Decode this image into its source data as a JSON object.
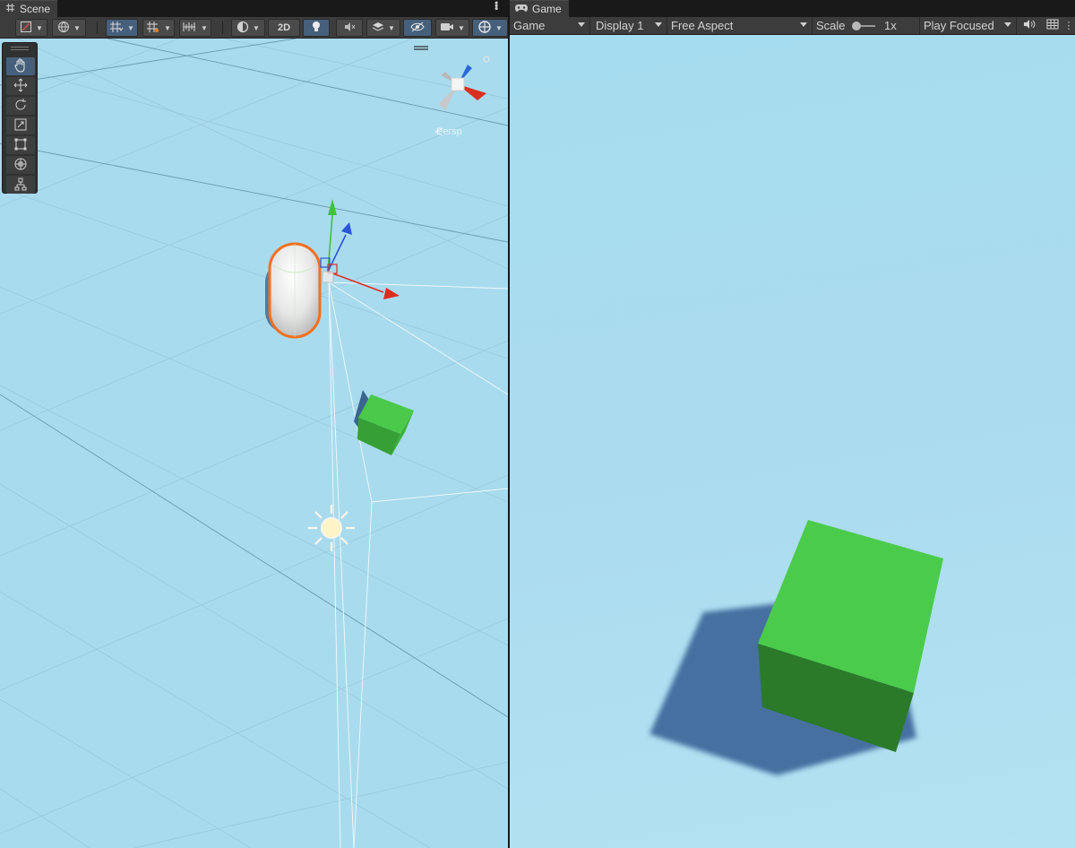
{
  "scene": {
    "tab_label": "Scene",
    "toolbar": {
      "mode_2d_label": "2D"
    },
    "tools": [
      {
        "name": "hand-tool",
        "icon": "hand-icon",
        "active": true
      },
      {
        "name": "move-tool",
        "icon": "move-arrows-icon",
        "active": false
      },
      {
        "name": "rotate-tool",
        "icon": "rotate-icon",
        "active": false
      },
      {
        "name": "scale-tool",
        "icon": "scale-icon",
        "active": false
      },
      {
        "name": "rect-tool",
        "icon": "rect-transform-icon",
        "active": false
      },
      {
        "name": "transform-tool",
        "icon": "transform-icon",
        "active": false
      },
      {
        "name": "custom-tool",
        "icon": "custom-tool-icon",
        "active": false
      }
    ],
    "gizmo_label": "Persp",
    "colors": {
      "background": "#a9dbee",
      "selection_outline": "#f07020",
      "axis_x": "#e02a20",
      "axis_y": "#3ec33a",
      "axis_z": "#2a55d8",
      "cube": "#4bc94b"
    }
  },
  "game": {
    "tab_label": "Game",
    "toolbar": {
      "view_label": "Game",
      "display_label": "Display 1",
      "aspect_label": "Free Aspect",
      "scale_label": "Scale",
      "scale_value": "1x",
      "play_mode_label": "Play Focused"
    },
    "colors": {
      "sky": "#a8ddf0",
      "cube_top": "#4bcb4b",
      "cube_side": "#2a7a2a",
      "shadow": "#4470a0"
    }
  }
}
